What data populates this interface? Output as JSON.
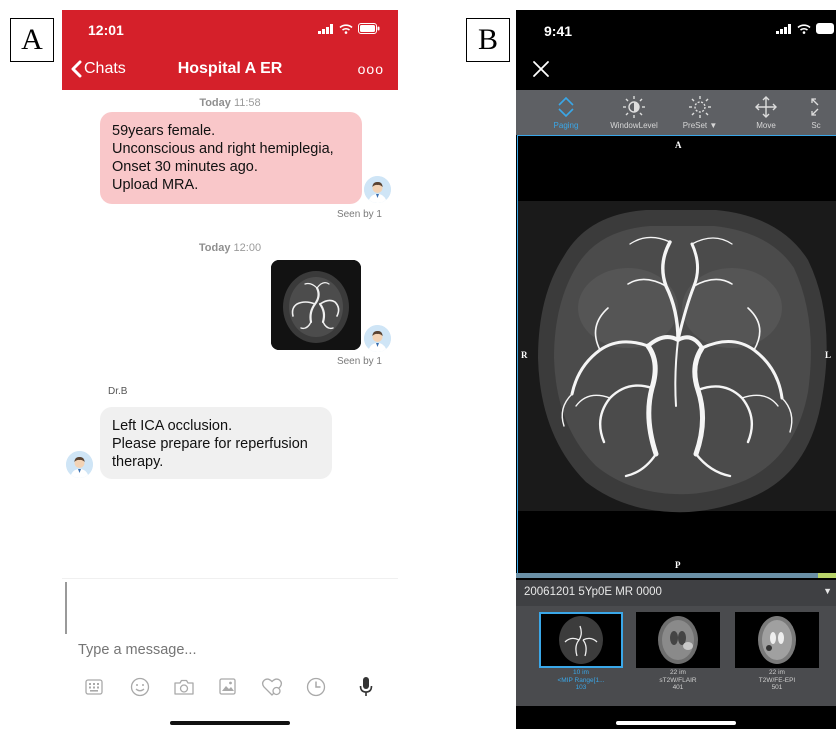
{
  "panels": {
    "a": "A",
    "b": "B"
  },
  "phone_a": {
    "status_time": "12:01",
    "nav": {
      "back_label": "Chats",
      "title": "Hospital A ER",
      "more": "ooo"
    },
    "messages": {
      "ts1_day": "Today",
      "ts1_time": "11:58",
      "msg1_lines": [
        "59years female.",
        "Unconscious and right hemiplegia,",
        "Onset 30 minutes ago.",
        "Upload MRA."
      ],
      "seen1": "Seen by 1",
      "ts2_day": "Today",
      "ts2_time": "12:00",
      "seen2": "Seen by 1",
      "sender": "Dr.B",
      "msg3_lines": [
        "Left ICA occlusion.",
        "Please prepare for reperfusion",
        "therapy."
      ]
    },
    "input_placeholder": "Type a message...",
    "toolbar_icons": [
      "keyboard-icon",
      "emoji-icon",
      "camera-icon",
      "gallery-icon",
      "sticker-icon",
      "clock-icon",
      "microphone-icon"
    ],
    "colors": {
      "header": "#d5202a",
      "outgoing_bubble": "#f9c7c9",
      "incoming_bubble": "#f0f0f0"
    }
  },
  "phone_b": {
    "status_time": "9:41",
    "tools": [
      {
        "label": "Paging",
        "icon": "paging-icon",
        "active": true
      },
      {
        "label": "WindowLevel",
        "icon": "window-level-icon",
        "active": false
      },
      {
        "label": "PreSet ▼",
        "icon": "preset-icon",
        "active": false
      },
      {
        "label": "Move",
        "icon": "move-icon",
        "active": false
      },
      {
        "label": "Sc",
        "icon": "scale-icon",
        "active": false
      }
    ],
    "orientation": {
      "top": "A",
      "bottom": "P",
      "left": "R",
      "right": "L"
    },
    "series_title": "20061201 5Yp0E MR 0000",
    "series": [
      {
        "line1": "10 im",
        "line2": "<MIP Range[1...",
        "line3": "103",
        "selected": true
      },
      {
        "line1": "22 im",
        "line2": "sT2W/FLAIR",
        "line3": "401",
        "selected": false
      },
      {
        "line1": "22 im",
        "line2": "T2W/FE-EPI",
        "line3": "501",
        "selected": false
      }
    ],
    "colors": {
      "accent": "#3aa7e8",
      "toolbar": "#5e6064"
    }
  }
}
